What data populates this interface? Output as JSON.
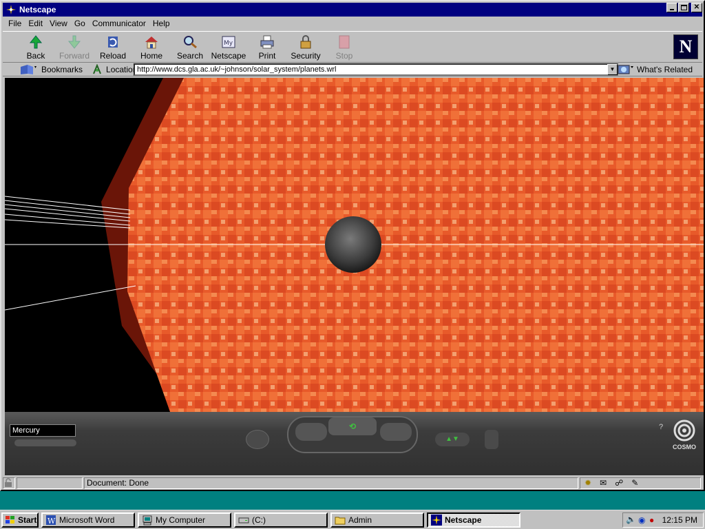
{
  "window": {
    "title": "Netscape"
  },
  "menu": [
    "File",
    "Edit",
    "View",
    "Go",
    "Communicator",
    "Help"
  ],
  "toolbar": {
    "back": "Back",
    "forward": "Forward",
    "reload": "Reload",
    "home": "Home",
    "search": "Search",
    "netscape": "Netscape",
    "print": "Print",
    "security": "Security",
    "stop": "Stop"
  },
  "location": {
    "bookmarks": "Bookmarks",
    "label": "Location:",
    "url": "http://www.dcs.gla.ac.uk/~johnson/solar_system/planets.wrl",
    "related": "What's Related"
  },
  "vrml": {
    "viewpoint": "Mercury",
    "brand": "COSMO"
  },
  "status": {
    "text": "Document: Done"
  },
  "taskbar": {
    "start": "Start",
    "tasks": [
      "Microsoft Word",
      "My Computer",
      "(C:)",
      "Admin",
      "Netscape"
    ],
    "clock": "12:15 PM"
  },
  "colors": {
    "titlebar": "#000080",
    "desktop": "#008080",
    "sun": "#e85a2a"
  }
}
